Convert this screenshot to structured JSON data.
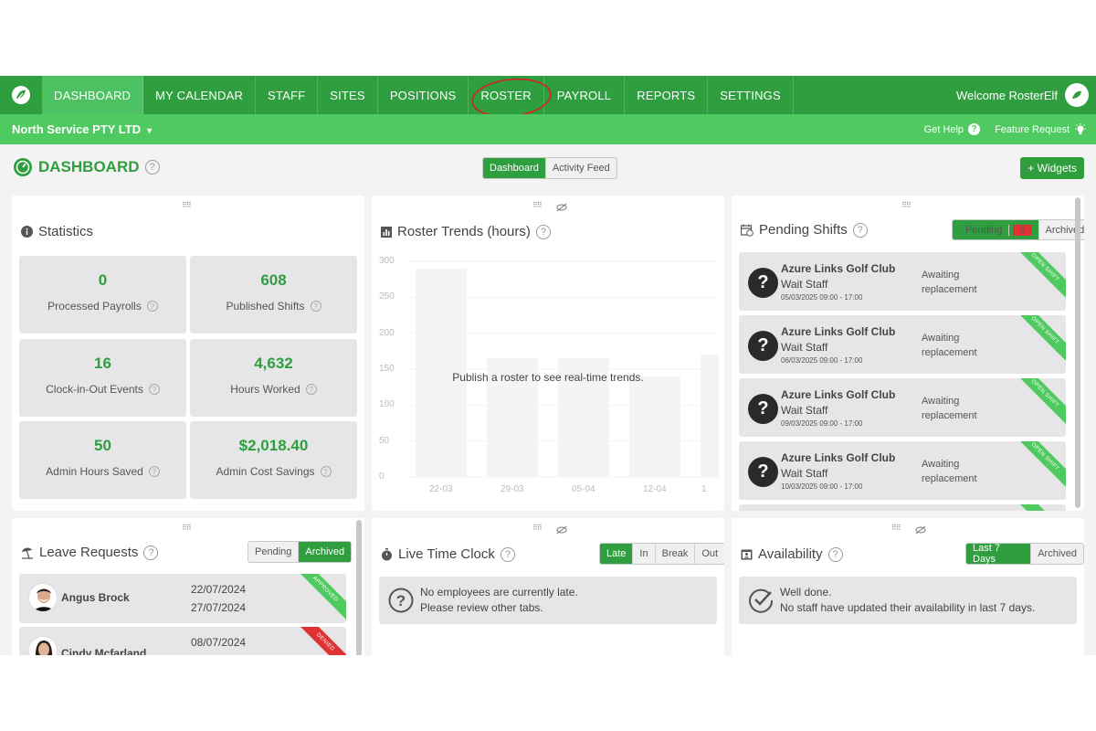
{
  "nav": {
    "items": [
      {
        "label": "DASHBOARD"
      },
      {
        "label": "MY CALENDAR"
      },
      {
        "label": "STAFF"
      },
      {
        "label": "SITES"
      },
      {
        "label": "POSITIONS"
      },
      {
        "label": "ROSTER"
      },
      {
        "label": "PAYROLL"
      },
      {
        "label": "REPORTS"
      },
      {
        "label": "SETTINGS"
      }
    ],
    "welcome": "Welcome RosterElf"
  },
  "subbar": {
    "company": "North Service PTY LTD",
    "get_help": "Get Help",
    "feature_request": "Feature Request"
  },
  "page": {
    "title": "DASHBOARD",
    "view_tabs": [
      "Dashboard",
      "Activity Feed"
    ],
    "widgets_button": "+ Widgets"
  },
  "statistics": {
    "title": "Statistics",
    "items": [
      {
        "value": "0",
        "label": "Processed Payrolls"
      },
      {
        "value": "608",
        "label": "Published Shifts"
      },
      {
        "value": "16",
        "label": "Clock-in-Out Events"
      },
      {
        "value": "4,632",
        "label": "Hours Worked"
      },
      {
        "value": "50",
        "label": "Admin Hours Saved"
      },
      {
        "value": "$2,018.40",
        "label": "Admin Cost Savings"
      }
    ]
  },
  "roster_trends": {
    "title": "Roster Trends (hours)",
    "message": "Publish a roster to see real-time trends."
  },
  "chart_data": {
    "type": "bar",
    "title": "Roster Trends (hours)",
    "categories": [
      "22-03",
      "29-03",
      "05-04",
      "12-04",
      "1"
    ],
    "values": [
      290,
      165,
      165,
      140,
      170
    ],
    "ylim": [
      0,
      300
    ],
    "yticks": [
      0,
      50,
      100,
      150,
      200,
      250,
      300
    ],
    "grid": true
  },
  "pending_shifts": {
    "title": "Pending Shifts",
    "tabs": [
      "Pending",
      "Archived"
    ],
    "pending_count": "5",
    "ribbon": "OPEN SHIFT",
    "items": [
      {
        "site": "Azure Links Golf Club",
        "position": "Wait Staff",
        "time": "05/03/2025 09:00 - 17:00",
        "status": "Awaiting replacement"
      },
      {
        "site": "Azure Links Golf Club",
        "position": "Wait Staff",
        "time": "06/03/2025 09:00 - 17:00",
        "status": "Awaiting replacement"
      },
      {
        "site": "Azure Links Golf Club",
        "position": "Wait Staff",
        "time": "09/03/2025 09:00 - 17:00",
        "status": "Awaiting replacement"
      },
      {
        "site": "Azure Links Golf Club",
        "position": "Wait Staff",
        "time": "10/03/2025 09:00 - 17:00",
        "status": "Awaiting replacement"
      }
    ]
  },
  "leave_requests": {
    "title": "Leave Requests",
    "tabs": [
      "Pending",
      "Archived"
    ],
    "items": [
      {
        "name": "Angus Brock",
        "from": "22/07/2024",
        "to": "27/07/2024",
        "status": "APPROVED"
      },
      {
        "name": "Cindy Mcfarland",
        "from": "08/07/2024",
        "to": "",
        "status": "DENIED"
      }
    ]
  },
  "live_time_clock": {
    "title": "Live Time Clock",
    "tabs": [
      "Late",
      "In",
      "Break",
      "Out"
    ],
    "line1": "No employees are currently late.",
    "line2": "Please review other tabs."
  },
  "availability": {
    "title": "Availability",
    "tabs": [
      "Last 7 Days",
      "Archived"
    ],
    "line1": "Well done.",
    "line2": "No staff have updated their availability in last 7 days."
  },
  "colors": {
    "brand_dark": "#2e9e3e",
    "brand_light": "#4fca60",
    "denied": "#dd3333",
    "annotation": "#d92020"
  }
}
